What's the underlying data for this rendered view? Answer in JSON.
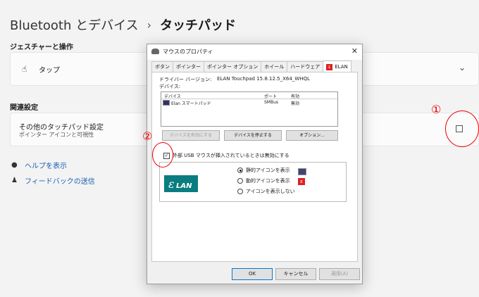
{
  "breadcrumb": {
    "parent": "Bluetooth とデバイス",
    "separator": "›",
    "current": "タッチパッド"
  },
  "gestures": {
    "section_title": "ジェスチャーと操作",
    "tap_label": "タップ"
  },
  "related": {
    "section_title": "関連設定",
    "more_title": "その他のタッチパッド設定",
    "more_sub": "ポインター アイコンと可視性"
  },
  "links": {
    "help": "ヘルプを表示",
    "feedback": "フィードバックの送信"
  },
  "annotations": {
    "one": "①",
    "two": "②",
    "color": "#e00000"
  },
  "dialog": {
    "title": "マウスのプロパティ",
    "close_glyph": "✕",
    "tabs": [
      "ボタン",
      "ポインター",
      "ポインター オプション",
      "ホイール",
      "ハードウェア",
      "ELAN"
    ],
    "active_tab": "ELAN",
    "elan_badge": "ε",
    "driver_label": "ドライバー バージョン:",
    "driver_value": "ELAN Touchpad 15.8.12.5_X64_WHQL",
    "devices_label": "デバイス:",
    "devices_columns": [
      "デバイス",
      "ポート",
      "有効"
    ],
    "devices_rows": [
      {
        "name": "Elan スマートパッド",
        "port": "SMBus",
        "enabled": "無効"
      }
    ],
    "buttons": {
      "enable": "デバイスを有効にする",
      "stop": "デバイスを停止する",
      "options": "オプション..."
    },
    "checkbox_label": "外部 USB マウスが挿入されているときは無効にする",
    "checkbox_checked": true,
    "logo_text": "LAN",
    "radios": [
      {
        "label": "静的アイコンを表示",
        "checked": true
      },
      {
        "label": "動的アイコンを表示",
        "checked": false
      },
      {
        "label": "アイコンを表示しない",
        "checked": false
      }
    ],
    "footer": {
      "ok": "OK",
      "cancel": "キャンセル",
      "apply": "適用(A)"
    }
  }
}
